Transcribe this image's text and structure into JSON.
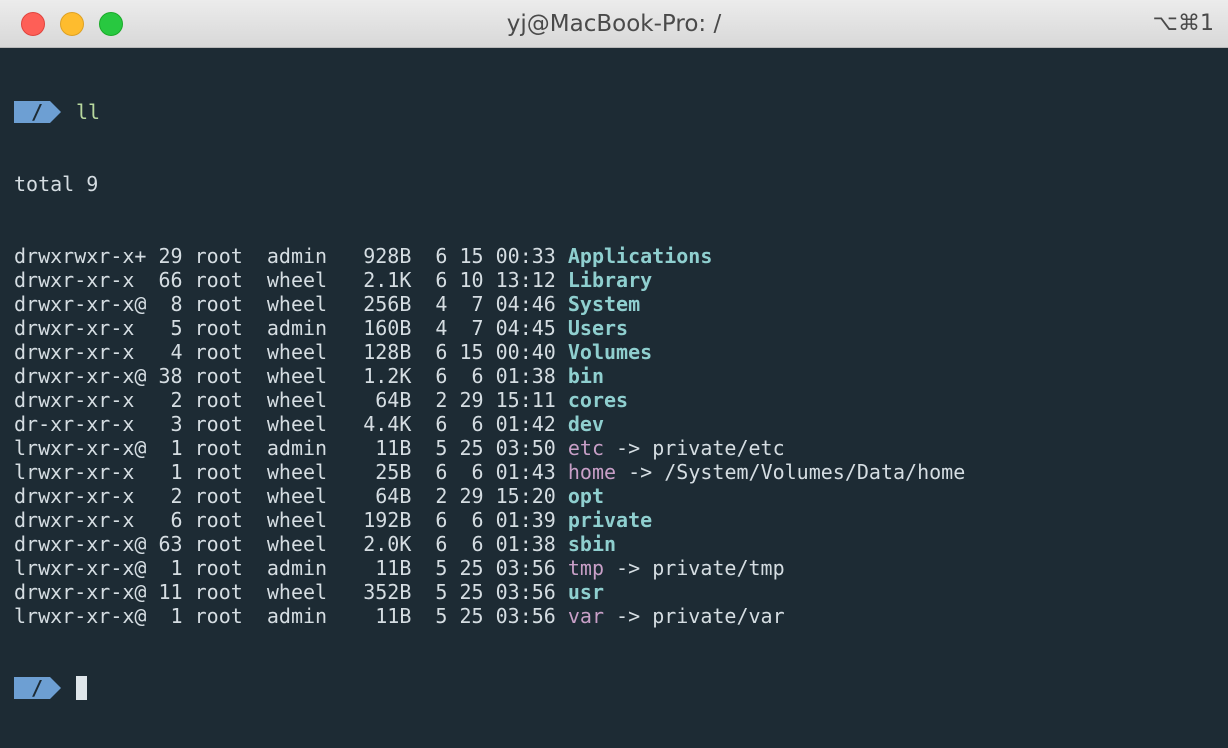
{
  "window": {
    "title": "yj@MacBook-Pro: /",
    "shortcut": "⌥⌘1"
  },
  "prompt": {
    "path": "/",
    "command": "ll"
  },
  "total_line": "total 9",
  "listing": [
    {
      "meta": "drwxrwxr-x+ 29 root  admin   928B  6 15 00:33 ",
      "name": "Applications",
      "kind": "dir"
    },
    {
      "meta": "drwxr-xr-x  66 root  wheel   2.1K  6 10 13:12 ",
      "name": "Library",
      "kind": "dir"
    },
    {
      "meta": "drwxr-xr-x@  8 root  wheel   256B  4  7 04:46 ",
      "name": "System",
      "kind": "dir"
    },
    {
      "meta": "drwxr-xr-x   5 root  admin   160B  4  7 04:45 ",
      "name": "Users",
      "kind": "dir"
    },
    {
      "meta": "drwxr-xr-x   4 root  wheel   128B  6 15 00:40 ",
      "name": "Volumes",
      "kind": "dir"
    },
    {
      "meta": "drwxr-xr-x@ 38 root  wheel   1.2K  6  6 01:38 ",
      "name": "bin",
      "kind": "dir"
    },
    {
      "meta": "drwxr-xr-x   2 root  wheel    64B  2 29 15:11 ",
      "name": "cores",
      "kind": "dir"
    },
    {
      "meta": "dr-xr-xr-x   3 root  wheel   4.4K  6  6 01:42 ",
      "name": "dev",
      "kind": "dir"
    },
    {
      "meta": "lrwxr-xr-x@  1 root  admin    11B  5 25 03:50 ",
      "name": "etc",
      "kind": "link",
      "arrow": " -> ",
      "target": "private/etc"
    },
    {
      "meta": "lrwxr-xr-x   1 root  wheel    25B  6  6 01:43 ",
      "name": "home",
      "kind": "link",
      "arrow": " -> ",
      "target": "/System/Volumes/Data/home"
    },
    {
      "meta": "drwxr-xr-x   2 root  wheel    64B  2 29 15:20 ",
      "name": "opt",
      "kind": "dir"
    },
    {
      "meta": "drwxr-xr-x   6 root  wheel   192B  6  6 01:39 ",
      "name": "private",
      "kind": "dir"
    },
    {
      "meta": "drwxr-xr-x@ 63 root  wheel   2.0K  6  6 01:38 ",
      "name": "sbin",
      "kind": "dir"
    },
    {
      "meta": "lrwxr-xr-x@  1 root  admin    11B  5 25 03:56 ",
      "name": "tmp",
      "kind": "link",
      "arrow": " -> ",
      "target": "private/tmp"
    },
    {
      "meta": "drwxr-xr-x@ 11 root  wheel   352B  5 25 03:56 ",
      "name": "usr",
      "kind": "dir"
    },
    {
      "meta": "lrwxr-xr-x@  1 root  admin    11B  5 25 03:56 ",
      "name": "var",
      "kind": "link",
      "arrow": " -> ",
      "target": "private/var"
    }
  ],
  "colors": {
    "background": "#1d2b34",
    "prompt_segment": "#6d9fd3",
    "command": "#b8d89e",
    "directory": "#8fcfcf",
    "symlink": "#c89fc7",
    "text": "#d5dde2"
  }
}
